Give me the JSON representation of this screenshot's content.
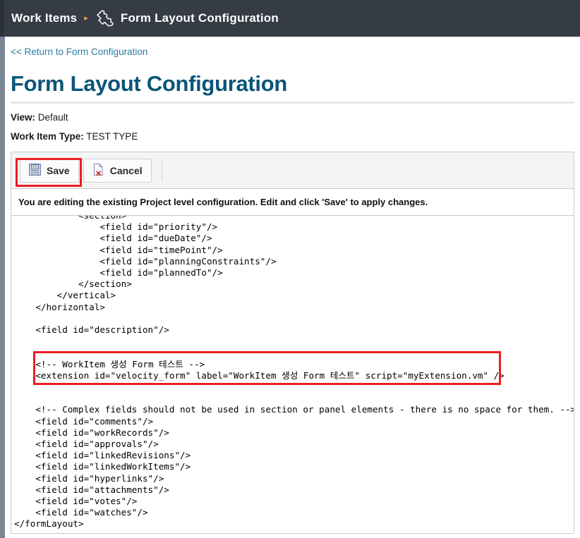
{
  "header": {
    "breadcrumb_root": "Work Items",
    "breadcrumb_separator": "▸",
    "breadcrumb_icon": "puzzle-piece-icon",
    "breadcrumb_current": "Form Layout Configuration",
    "background_color": "#353c46"
  },
  "page": {
    "return_link": "<< Return to Form Configuration",
    "title": "Form Layout Configuration",
    "title_color": "#0b5579",
    "view_label": "View:",
    "view_value": "Default",
    "work_item_type_label": "Work Item Type:",
    "work_item_type_value": "TEST TYPE"
  },
  "toolbar": {
    "save_label": "Save",
    "save_icon": "floppy-disk-icon",
    "cancel_label": "Cancel",
    "cancel_icon": "document-delete-icon",
    "highlight_color": "#ec1c24"
  },
  "notice": {
    "text": "You are editing the existing Project level configuration. Edit and click 'Save' to apply changes."
  },
  "editor": {
    "content": "            <section>\n                <field id=\"priority\"/>\n                <field id=\"dueDate\"/>\n                <field id=\"timePoint\"/>\n                <field id=\"planningConstraints\"/>\n                <field id=\"plannedTo\"/>\n            </section>\n        </vertical>\n    </horizontal>\n\n    <field id=\"description\"/>\n\n\n    <!-- WorkItem 생성 Form 테스트 -->\n    <extension id=\"velocity_form\" label=\"WorkItem 생성 Form 테스트\" script=\"myExtension.vm\" />\n\n\n    <!-- Complex fields should not be used in section or panel elements - there is no space for them. -->\n    <field id=\"comments\"/>\n    <field id=\"workRecords\"/>\n    <field id=\"approvals\"/>\n    <field id=\"linkedRevisions\"/>\n    <field id=\"linkedWorkItems\"/>\n    <field id=\"hyperlinks\"/>\n    <field id=\"attachments\"/>\n    <field id=\"votes\"/>\n    <field id=\"watches\"/>\n</formLayout>",
    "highlighted_lines": [
      "<!-- WorkItem 생성 Form 테스트 -->",
      "<extension id=\"velocity_form\" label=\"WorkItem 생성 Form 테스트\" script=\"myExtension.vm\" />"
    ]
  }
}
